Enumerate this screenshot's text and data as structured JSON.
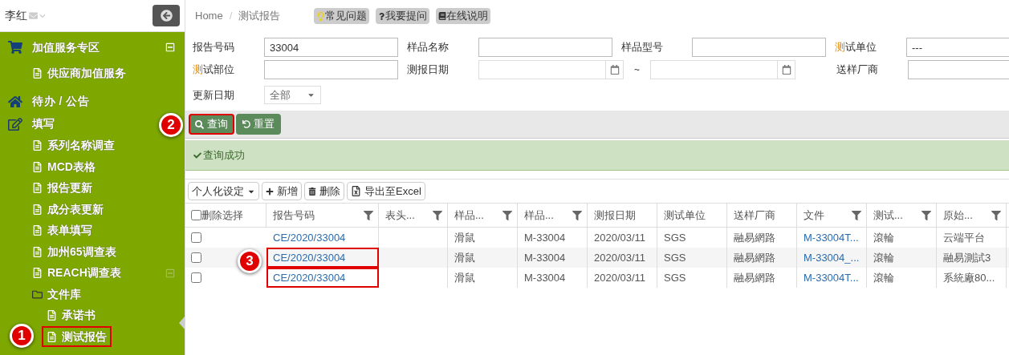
{
  "sidebar": {
    "user": "李红",
    "items": [
      {
        "kind": "group",
        "label": "加值服务专区",
        "expanded": true,
        "children": [
          {
            "kind": "page",
            "label": "供应商加值服务",
            "selected": false
          }
        ]
      },
      {
        "kind": "link",
        "label": "待办 / 公告"
      },
      {
        "kind": "group",
        "label": "填写",
        "children": [
          {
            "kind": "page",
            "label": "系列名称调查",
            "selected": false
          },
          {
            "kind": "page",
            "label": "MCD表格",
            "selected": false
          },
          {
            "kind": "page",
            "label": "报告更新",
            "selected": false
          },
          {
            "kind": "page",
            "label": "成分表更新",
            "selected": false
          },
          {
            "kind": "page",
            "label": "表单填写",
            "selected": false
          },
          {
            "kind": "page",
            "label": "加州65调查表",
            "selected": false
          },
          {
            "kind": "page",
            "label": "REACH调查表",
            "selected": false,
            "expanded": true
          },
          {
            "kind": "folder",
            "label": "文件库",
            "children": [
              {
                "kind": "page",
                "label": "承诺书",
                "selected": false
              },
              {
                "kind": "page",
                "label": "测试报告",
                "selected": true,
                "callout": "1"
              }
            ]
          }
        ]
      }
    ]
  },
  "breadcrumb": {
    "items": [
      "Home",
      "测试报告"
    ],
    "separator": "/"
  },
  "help_buttons": [
    "常见问题",
    "我要提问",
    "在线说明"
  ],
  "filters": [
    {
      "label": "报告号码",
      "kind": "text",
      "value": "33004"
    },
    {
      "label": "样品名称",
      "kind": "text"
    },
    {
      "label": "样品型号",
      "kind": "text"
    },
    {
      "label": "测试单位",
      "kind": "text",
      "required": true,
      "value": "---"
    },
    {
      "label": "测试部位",
      "kind": "text",
      "required": true
    },
    {
      "label": "测报日期",
      "kind": "daterange",
      "separator": "~"
    },
    {
      "label": "送样厂商",
      "kind": "text"
    },
    {
      "label": "更新日期",
      "kind": "select",
      "value": "全部"
    }
  ],
  "actions": [
    {
      "label": "查询",
      "highlighted": true,
      "callout": "2"
    },
    {
      "label": "重置",
      "highlighted": false
    }
  ],
  "message": "查询成功",
  "toolbar": [
    "个人化设定",
    "新增",
    "删除",
    "导出至Excel"
  ],
  "table": {
    "select_label": "删除选择",
    "select_all": false,
    "columns": [
      {
        "label": "报告号码",
        "filter": true,
        "kind": "link"
      },
      {
        "label": "表头...",
        "filter": true,
        "kind": "text"
      },
      {
        "label": "样品...",
        "filter": true,
        "kind": "text"
      },
      {
        "label": "样品...",
        "filter": true,
        "kind": "text"
      },
      {
        "label": "测报日期",
        "filter": false,
        "kind": "text"
      },
      {
        "label": "测试单位",
        "filter": false,
        "kind": "text"
      },
      {
        "label": "送样厂商",
        "filter": false,
        "kind": "text"
      },
      {
        "label": "文件",
        "filter": true,
        "kind": "link"
      },
      {
        "label": "测试...",
        "filter": true,
        "kind": "text"
      },
      {
        "label": "原始...",
        "filter": true,
        "kind": "text"
      }
    ],
    "rows": [
      {
        "checked": false,
        "highlighted": false,
        "cells": [
          "CE/2020/33004",
          "",
          "滑鼠",
          "M-33004",
          "2020/03/11",
          "SGS",
          "融易網路",
          "M-33004T...",
          "滾輪",
          "云端平台"
        ]
      },
      {
        "checked": false,
        "highlighted": true,
        "cells": [
          "CE/2020/33004",
          "",
          "滑鼠",
          "M-33004",
          "2020/03/11",
          "SGS",
          "融易網路",
          "M-33004_...",
          "滾輪",
          "融易測試3"
        ]
      },
      {
        "checked": false,
        "highlighted": true,
        "cells": [
          "CE/2020/33004",
          "",
          "滑鼠",
          "M-33004",
          "2020/03/11",
          "SGS",
          "融易網路",
          "M-33004T...",
          "滾輪",
          "系統廠80..."
        ]
      }
    ],
    "callout": "3"
  }
}
